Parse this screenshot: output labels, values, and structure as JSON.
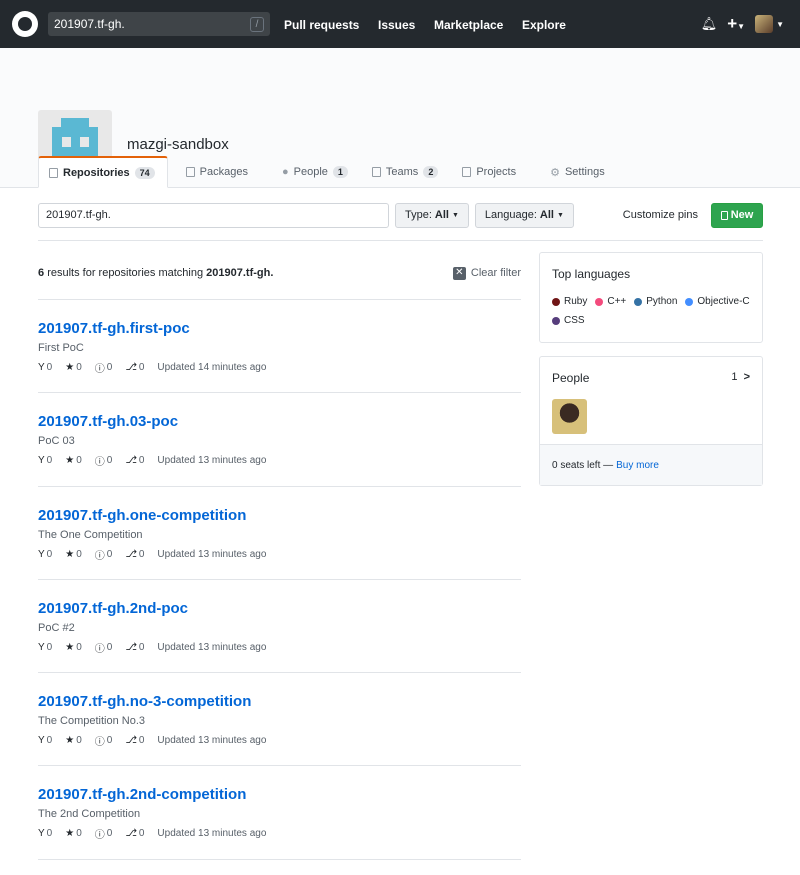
{
  "header": {
    "search_value": "201907.tf-gh.",
    "search_shortcut": "/",
    "nav": [
      "Pull requests",
      "Issues",
      "Marketplace",
      "Explore"
    ],
    "plus_label": "+"
  },
  "org": {
    "name": "mazgi-sandbox",
    "tabs": [
      {
        "label": "Repositories",
        "count": "74",
        "icon": "repo-icon",
        "active": true
      },
      {
        "label": "Packages",
        "count": "",
        "icon": "package-icon"
      },
      {
        "label": "People",
        "count": "1",
        "icon": "person-icon"
      },
      {
        "label": "Teams",
        "count": "2",
        "icon": "team-icon"
      },
      {
        "label": "Projects",
        "count": "",
        "icon": "project-icon"
      },
      {
        "label": "Settings",
        "count": "",
        "icon": "gear-icon"
      }
    ]
  },
  "filter": {
    "query": "201907.tf-gh.",
    "type_label": "Type:",
    "type_value": "All",
    "language_label": "Language:",
    "language_value": "All",
    "customize_pins": "Customize pins",
    "new_label": "New"
  },
  "results": {
    "count": "6",
    "text": "results for repositories matching",
    "query": "201907.tf-gh.",
    "clear_filter": "Clear filter"
  },
  "repos": [
    {
      "name": "201907.tf-gh.first-poc",
      "desc": "First PoC",
      "forks": "0",
      "stars": "0",
      "issues": "0",
      "prs": "0",
      "updated": "Updated 14 minutes ago"
    },
    {
      "name": "201907.tf-gh.03-poc",
      "desc": "PoC 03",
      "forks": "0",
      "stars": "0",
      "issues": "0",
      "prs": "0",
      "updated": "Updated 13 minutes ago"
    },
    {
      "name": "201907.tf-gh.one-competition",
      "desc": "The One Competition",
      "forks": "0",
      "stars": "0",
      "issues": "0",
      "prs": "0",
      "updated": "Updated 13 minutes ago"
    },
    {
      "name": "201907.tf-gh.2nd-poc",
      "desc": "PoC #2",
      "forks": "0",
      "stars": "0",
      "issues": "0",
      "prs": "0",
      "updated": "Updated 13 minutes ago"
    },
    {
      "name": "201907.tf-gh.no-3-competition",
      "desc": "The Competition No.3",
      "forks": "0",
      "stars": "0",
      "issues": "0",
      "prs": "0",
      "updated": "Updated 13 minutes ago"
    },
    {
      "name": "201907.tf-gh.2nd-competition",
      "desc": "The 2nd Competition",
      "forks": "0",
      "stars": "0",
      "issues": "0",
      "prs": "0",
      "updated": "Updated 13 minutes ago"
    }
  ],
  "sidebar": {
    "languages_title": "Top languages",
    "languages": [
      {
        "name": "Ruby",
        "color": "#701516"
      },
      {
        "name": "C++",
        "color": "#f34b7d"
      },
      {
        "name": "Python",
        "color": "#3572A5"
      },
      {
        "name": "Objective-C",
        "color": "#438eff"
      },
      {
        "name": "CSS",
        "color": "#563d7c"
      }
    ],
    "people_title": "People",
    "people_count": "1",
    "seats_text": "0 seats left —",
    "buy_more": "Buy more"
  }
}
